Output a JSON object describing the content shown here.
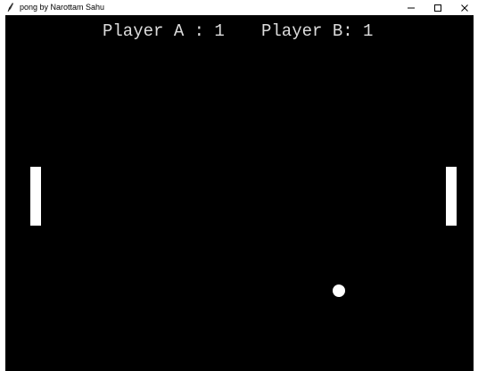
{
  "window": {
    "title": "pong by Narottam Sahu",
    "app_icon": "feather-icon",
    "controls": [
      "minimize-icon",
      "maximize-icon",
      "close-icon"
    ]
  },
  "game": {
    "background_color": "#000000",
    "foreground_color": "#ffffff",
    "score": {
      "player_a_label": "Player A : 1",
      "player_b_label": "Player B: 1"
    }
  }
}
